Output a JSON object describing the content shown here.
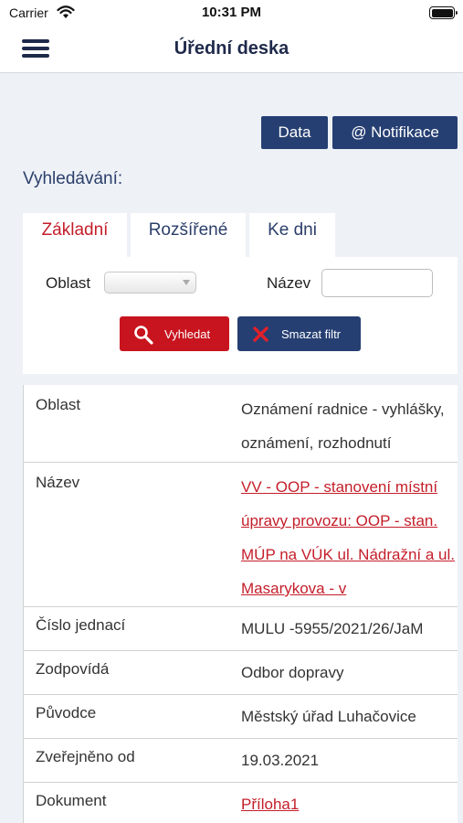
{
  "status_bar": {
    "carrier": "Carrier",
    "time": "10:31 PM"
  },
  "nav": {
    "title": "Úřední deska"
  },
  "actions": {
    "data_label": "Data",
    "notify_label": "@ Notifikace"
  },
  "search": {
    "heading": "Vyhledávání:",
    "tabs": [
      {
        "label": "Základní",
        "active": true
      },
      {
        "label": "Rozšířené",
        "active": false
      },
      {
        "label": "Ke dni",
        "active": false
      }
    ],
    "oblast_label": "Oblast",
    "oblast_value": "",
    "nazev_label": "Název",
    "nazev_value": "",
    "search_button": "Vyhledat",
    "clear_button": "Smazat filtr"
  },
  "detail": {
    "rows": [
      {
        "label": "Oblast",
        "value": "Oznámení radnice - vyhlášky, oznámení, rozhodnutí",
        "link": false
      },
      {
        "label": "Název",
        "value": "VV - OOP - stanovení místní úpravy provozu: OOP - stan. MÚP na VÚK ul. Nádražní a ul. Masarykova - v",
        "link": true
      },
      {
        "label": "Číslo jednací",
        "value": "MULU -5955/2021/26/JaM",
        "link": false
      },
      {
        "label": "Zodpovídá",
        "value": "Odbor dopravy",
        "link": false
      },
      {
        "label": "Původce",
        "value": "Městský úřad Luhačovice",
        "link": false
      },
      {
        "label": "Zveřejněno od",
        "value": "19.03.2021",
        "link": false
      },
      {
        "label": "Dokument",
        "value": "Příloha1",
        "link": true
      }
    ]
  },
  "colors": {
    "navy": "#263f72",
    "red": "#c8141e",
    "link_red": "#c41e2a",
    "background": "#eef2f7"
  }
}
